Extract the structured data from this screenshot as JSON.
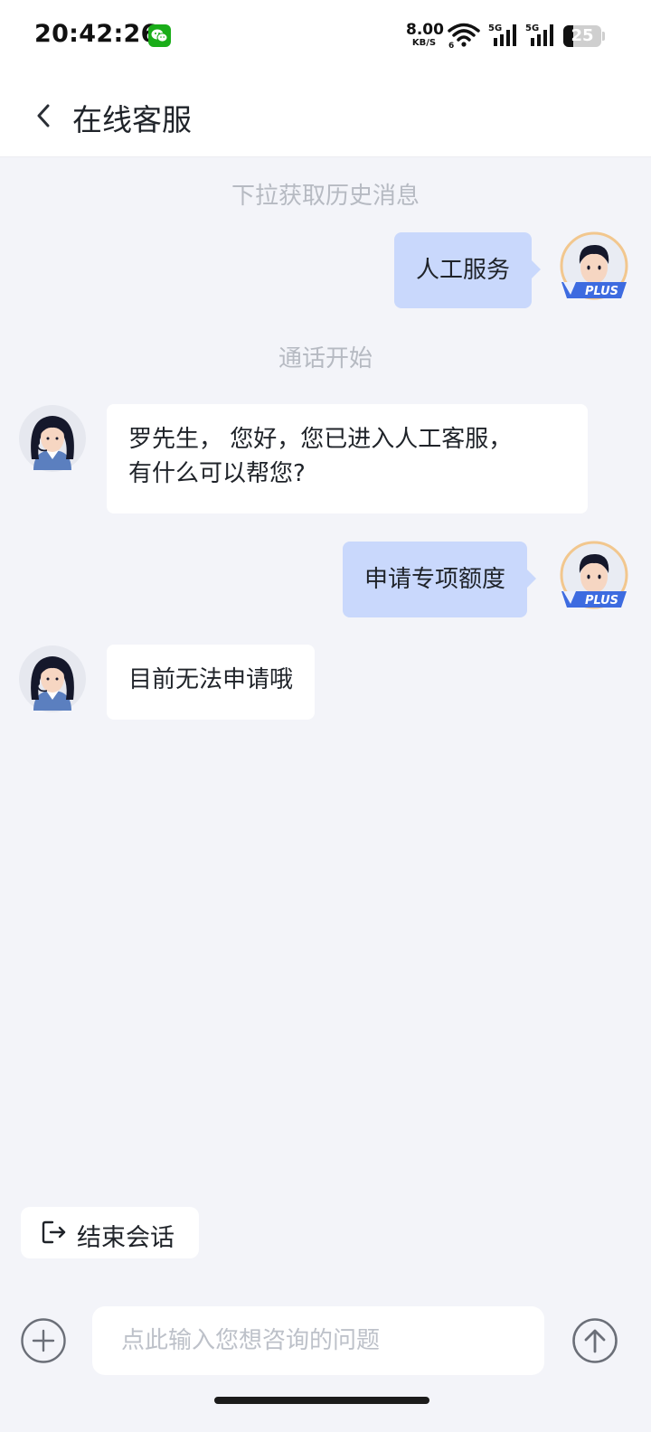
{
  "status_bar": {
    "time": "20:42:26",
    "net_speed_value": "8.00",
    "net_speed_unit": "KB/S",
    "signal_1": "5G",
    "signal_2": "5G",
    "battery": "25",
    "icons": [
      "wechat-icon",
      "wifi-icon",
      "signal-icon",
      "battery-icon"
    ]
  },
  "nav": {
    "back_icon": "chevron-left-icon",
    "title": "在线客服"
  },
  "chat": {
    "history_tip": "下拉获取历史消息",
    "call_start_tip": "通话开始",
    "messages": [
      {
        "from": "user",
        "text": "人工服务",
        "avatar_badge": "PLUS"
      },
      {
        "from": "agent",
        "lines": [
          "罗先生， 您好，您已进入人工客服，",
          "有什么可以帮您?"
        ]
      },
      {
        "from": "user",
        "text": "申请专项额度",
        "avatar_badge": "PLUS"
      },
      {
        "from": "agent",
        "lines": [
          "目前无法申请哦"
        ]
      }
    ]
  },
  "end_session": {
    "label": "结束会话",
    "icon": "exit-icon"
  },
  "composer": {
    "placeholder": "点此输入您想咨询的问题",
    "plus_icon": "plus-circle-icon",
    "send_icon": "send-arrow-icon"
  },
  "colors": {
    "background": "#F3F4F9",
    "user_bubble": "#C9D8FC",
    "agent_bubble": "#FFFFFF",
    "tip_text": "#B6BAC2",
    "badge": "#3D6BE0"
  }
}
